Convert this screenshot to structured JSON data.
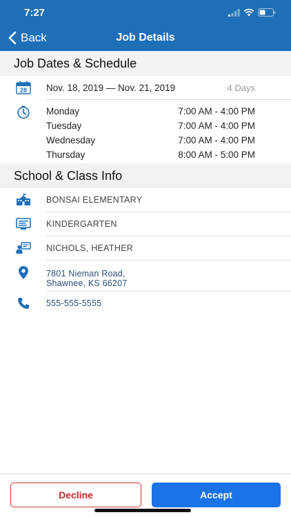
{
  "status_bar": {
    "time": "7:27"
  },
  "nav": {
    "back_label": "Back",
    "title": "Job Details"
  },
  "schedule_section": {
    "title": "Job Dates & Schedule",
    "calendar_day": "28",
    "date_range": "Nov. 18, 2019 — Nov. 21, 2019",
    "days_count": "4 Days",
    "days": [
      {
        "day": "Monday",
        "hours": "7:00 AM - 4:00 PM"
      },
      {
        "day": "Tuesday",
        "hours": "7:00 AM - 4:00 PM"
      },
      {
        "day": "Wednesday",
        "hours": "7:00 AM - 4:00 PM"
      },
      {
        "day": "Thursday",
        "hours": "8:00 AM - 5:00 PM"
      }
    ]
  },
  "school_section": {
    "title": "School & Class Info",
    "school": "BONSAI ELEMENTARY",
    "class": "KINDERGARTEN",
    "teacher": "NICHOLS, HEATHER",
    "address_line1": "7801 Nieman Road,",
    "address_line2": "Shawnee, KS 66207",
    "phone": "555-555-5555"
  },
  "actions": {
    "decline_label": "Decline",
    "accept_label": "Accept"
  },
  "colors": {
    "brand": "#1f6fb8",
    "accept": "#1a73e8",
    "decline": "#c0292b"
  }
}
